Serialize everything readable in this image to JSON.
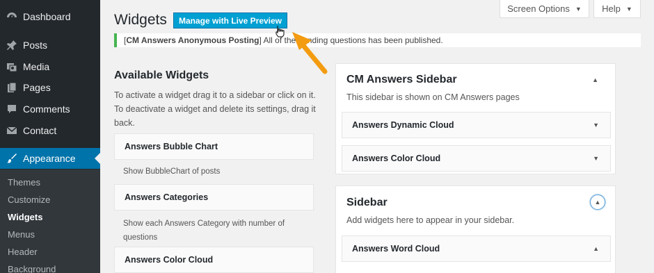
{
  "menu": {
    "items": [
      {
        "label": "Dashboard",
        "icon": "dashboard-icon"
      },
      {
        "label": "Posts",
        "icon": "pushpin-icon"
      },
      {
        "label": "Media",
        "icon": "media-icon"
      },
      {
        "label": "Pages",
        "icon": "pages-icon"
      },
      {
        "label": "Comments",
        "icon": "comment-icon"
      },
      {
        "label": "Contact",
        "icon": "envelope-icon"
      },
      {
        "label": "Appearance",
        "icon": "paintbrush-icon"
      }
    ],
    "submenu": [
      "Themes",
      "Customize",
      "Widgets",
      "Menus",
      "Header",
      "Background"
    ],
    "accent": "#0073aa"
  },
  "top_buttons": {
    "screen_options": "Screen Options",
    "help": "Help"
  },
  "page": {
    "title": "Widgets",
    "live_preview": "Manage with Live Preview"
  },
  "notice": {
    "bracket_open": "[",
    "plugin": "CM Answers Anonymous Posting",
    "bracket_close": "]",
    "text": " All of the pending questions has been published."
  },
  "available": {
    "title": "Available Widgets",
    "description": "To activate a widget drag it to a sidebar or click on it. To deactivate a widget and delete its settings, drag it back.",
    "widgets": [
      {
        "name": "Answers Bubble Chart",
        "description": "Show BubbleChart of posts"
      },
      {
        "name": "Answers Categories",
        "description": "Show each Answers Category with number of questions"
      },
      {
        "name": "Answers Color Cloud",
        "description": ""
      }
    ]
  },
  "sidebars": [
    {
      "title": "CM Answers Sidebar",
      "description": "This sidebar is shown on CM Answers pages",
      "widgets": [
        "Answers Dynamic Cloud",
        "Answers Color Cloud"
      ]
    },
    {
      "title": "Sidebar",
      "description": "Add widgets here to appear in your sidebar.",
      "widgets": [
        "Answers Word Cloud"
      ]
    }
  ],
  "colors": {
    "notice_border": "#46b450",
    "button_blue": "#00a0d2",
    "arrow_orange": "#f39c12"
  }
}
